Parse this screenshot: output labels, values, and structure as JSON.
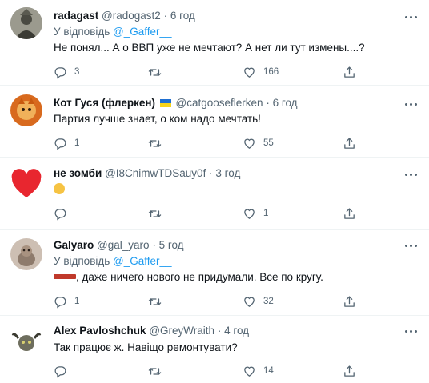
{
  "tweets": [
    {
      "name": "radagast",
      "handle": "@radogast2",
      "dot": "·",
      "time": "6 год",
      "reply_prefix": "У відповідь",
      "reply_to": "@_Gaffer__",
      "text": "Не понял... А о ВВП уже не мечтают? А нет ли тут измены....?",
      "replies": "3",
      "retweets": "",
      "likes": "166"
    },
    {
      "name": "Кот Гуся (флеркен)",
      "handle": "@catgooseflerken",
      "dot": "·",
      "time": "6 год",
      "text": "Партия лучше знает, о ком надо мечтать!",
      "replies": "1",
      "retweets": "",
      "likes": "55"
    },
    {
      "name": "не зомби",
      "handle": "@I8CnimwTDSauy0f",
      "dot": "·",
      "time": "3 год",
      "text_emoji": "rolling-on-floor-laughing-emoji",
      "replies": "",
      "retweets": "",
      "likes": "1"
    },
    {
      "name": "Galyaro",
      "handle": "@gal_yaro",
      "dot": "·",
      "time": "5 год",
      "reply_prefix": "У відповідь",
      "reply_to": "@_Gaffer__",
      "text": ", даже ничего нового не придумали. Все по кругу.",
      "replies": "1",
      "retweets": "",
      "likes": "32"
    },
    {
      "name": "Alex Pavloshchuk",
      "handle": "@GreyWraith",
      "dot": "·",
      "time": "4 год",
      "text": "Так працює ж. Навіщо ремонтувати?",
      "replies": "",
      "retweets": "",
      "likes": "14"
    }
  ],
  "colors": {
    "accent": "#1d9bf0",
    "muted": "#536471",
    "censor": "#c0392b"
  },
  "icons": [
    "more-icon",
    "reply-icon",
    "retweet-icon",
    "like-icon",
    "share-icon"
  ]
}
